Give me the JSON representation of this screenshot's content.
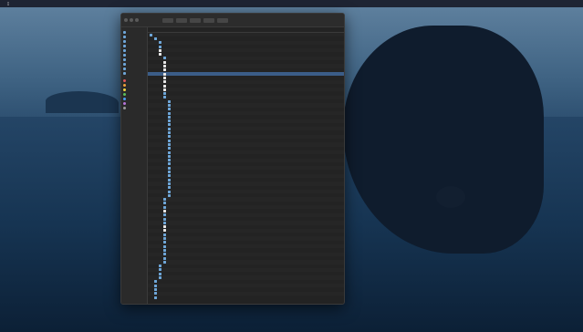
{
  "menubar": {
    "items": [
      "",
      "",
      "",
      "",
      "",
      "",
      ""
    ],
    "status": [
      "",
      ""
    ]
  },
  "window": {
    "title": "",
    "sidebar": {
      "sections": [
        "",
        ""
      ],
      "items": [
        "",
        "",
        "",
        "",
        "",
        "",
        "",
        "",
        "",
        ""
      ],
      "tags": [
        {
          "color": "#e0565b"
        },
        {
          "color": "#f0a13a"
        },
        {
          "color": "#f2d541"
        },
        {
          "color": "#5bbf5a"
        },
        {
          "color": "#4a9df0"
        },
        {
          "color": "#b774d8"
        },
        {
          "color": "#9a9a9a"
        }
      ]
    },
    "columns": [
      "",
      "",
      "",
      ""
    ],
    "rows": [
      {
        "indent": 0,
        "type": "folder"
      },
      {
        "indent": 1,
        "type": "folder"
      },
      {
        "indent": 2,
        "type": "folder"
      },
      {
        "indent": 2,
        "type": "folder"
      },
      {
        "indent": 2,
        "type": "doc"
      },
      {
        "indent": 2,
        "type": "doc"
      },
      {
        "indent": 3,
        "type": "folder"
      },
      {
        "indent": 3,
        "type": "doc"
      },
      {
        "indent": 3,
        "type": "doc"
      },
      {
        "indent": 3,
        "type": "doc"
      },
      {
        "indent": 3,
        "type": "doc",
        "selected": true
      },
      {
        "indent": 3,
        "type": "doc"
      },
      {
        "indent": 3,
        "type": "doc"
      },
      {
        "indent": 3,
        "type": "doc"
      },
      {
        "indent": 3,
        "type": "doc"
      },
      {
        "indent": 3,
        "type": "folder"
      },
      {
        "indent": 3,
        "type": "folder"
      },
      {
        "indent": 4,
        "type": "folder"
      },
      {
        "indent": 4,
        "type": "folder"
      },
      {
        "indent": 4,
        "type": "folder"
      },
      {
        "indent": 4,
        "type": "folder"
      },
      {
        "indent": 4,
        "type": "folder"
      },
      {
        "indent": 4,
        "type": "folder"
      },
      {
        "indent": 4,
        "type": "folder"
      },
      {
        "indent": 4,
        "type": "folder"
      },
      {
        "indent": 4,
        "type": "folder"
      },
      {
        "indent": 4,
        "type": "folder"
      },
      {
        "indent": 4,
        "type": "folder"
      },
      {
        "indent": 4,
        "type": "folder"
      },
      {
        "indent": 4,
        "type": "folder"
      },
      {
        "indent": 4,
        "type": "folder"
      },
      {
        "indent": 4,
        "type": "folder"
      },
      {
        "indent": 4,
        "type": "folder"
      },
      {
        "indent": 4,
        "type": "folder"
      },
      {
        "indent": 4,
        "type": "folder"
      },
      {
        "indent": 4,
        "type": "folder"
      },
      {
        "indent": 4,
        "type": "folder"
      },
      {
        "indent": 4,
        "type": "folder"
      },
      {
        "indent": 4,
        "type": "folder"
      },
      {
        "indent": 4,
        "type": "folder"
      },
      {
        "indent": 4,
        "type": "folder"
      },
      {
        "indent": 4,
        "type": "folder"
      },
      {
        "indent": 3,
        "type": "folder"
      },
      {
        "indent": 3,
        "type": "folder"
      },
      {
        "indent": 3,
        "type": "folder"
      },
      {
        "indent": 3,
        "type": "doc"
      },
      {
        "indent": 3,
        "type": "folder"
      },
      {
        "indent": 3,
        "type": "folder"
      },
      {
        "indent": 3,
        "type": "folder"
      },
      {
        "indent": 3,
        "type": "doc"
      },
      {
        "indent": 3,
        "type": "doc"
      },
      {
        "indent": 3,
        "type": "folder"
      },
      {
        "indent": 3,
        "type": "folder"
      },
      {
        "indent": 3,
        "type": "folder"
      },
      {
        "indent": 3,
        "type": "folder"
      },
      {
        "indent": 3,
        "type": "folder"
      },
      {
        "indent": 3,
        "type": "folder"
      },
      {
        "indent": 3,
        "type": "folder"
      },
      {
        "indent": 3,
        "type": "folder"
      },
      {
        "indent": 2,
        "type": "folder"
      },
      {
        "indent": 2,
        "type": "folder"
      },
      {
        "indent": 2,
        "type": "folder"
      },
      {
        "indent": 2,
        "type": "folder"
      },
      {
        "indent": 1,
        "type": "folder"
      },
      {
        "indent": 1,
        "type": "folder"
      },
      {
        "indent": 1,
        "type": "folder"
      },
      {
        "indent": 1,
        "type": "folder"
      },
      {
        "indent": 1,
        "type": "folder"
      }
    ]
  }
}
